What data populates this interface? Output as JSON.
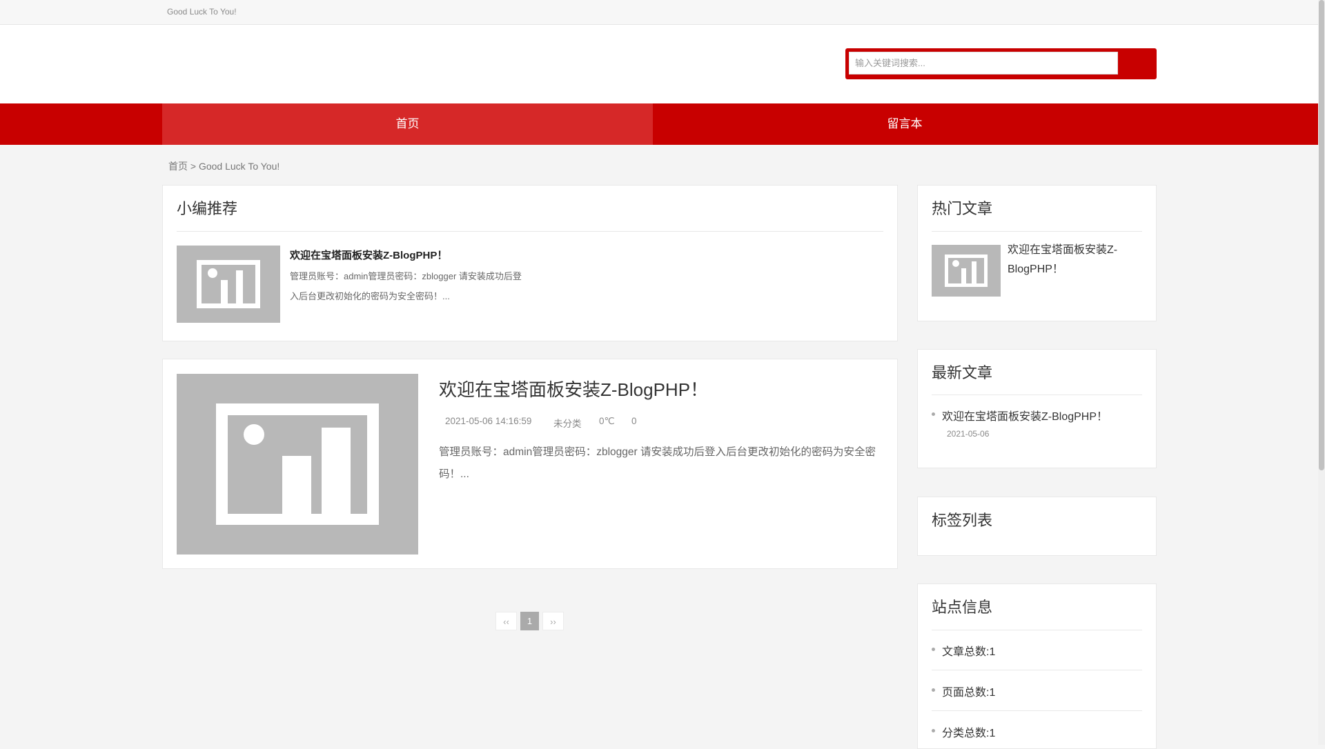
{
  "topbar": {
    "slogan": "Good Luck To You!"
  },
  "search": {
    "placeholder": "输入关键词搜索..."
  },
  "nav": {
    "items": [
      {
        "label": "首页",
        "active": true
      },
      {
        "label": "留言本",
        "active": false
      }
    ]
  },
  "breadcrumb": {
    "home": "首页",
    "separator": " > ",
    "current": "Good Luck To You!"
  },
  "recommend": {
    "title": "小编推荐",
    "article": {
      "title": "欢迎在宝塔面板安装Z-BlogPHP！",
      "excerpt": "管理员账号：admin管理员密码：zblogger 请安装成功后登入后台更改初始化的密码为安全密码！..."
    }
  },
  "article": {
    "title": "欢迎在宝塔面板安装Z-BlogPHP！",
    "date": "2021-05-06 14:16:59",
    "category": "未分类",
    "temperature": "0℃",
    "comments": "0",
    "excerpt": "管理员账号：admin管理员密码：zblogger 请安装成功后登入后台更改初始化的密码为安全密码！..."
  },
  "pagination": {
    "prev": "‹‹",
    "current": "1",
    "next": "››"
  },
  "sidebar": {
    "hot": {
      "title": "热门文章",
      "item_title": "欢迎在宝塔面板安装Z-BlogPHP！"
    },
    "latest": {
      "title": "最新文章",
      "item_title": "欢迎在宝塔面板安装Z-BlogPHP！",
      "item_date": "2021-05-06"
    },
    "tags": {
      "title": "标签列表"
    },
    "site_info": {
      "title": "站点信息",
      "items": [
        "文章总数:1",
        "页面总数:1",
        "分类总数:1"
      ]
    }
  },
  "colors": {
    "brand": "#c80000",
    "nav_active": "#d62828",
    "placeholder_gray": "#b8b8b8"
  },
  "icons": {
    "thumbnail": "image-placeholder-icon"
  }
}
